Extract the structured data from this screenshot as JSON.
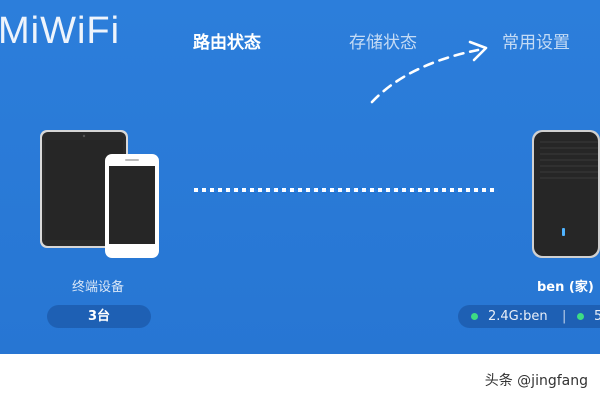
{
  "brand": {
    "name": "MiWiFi"
  },
  "nav": {
    "tabs": [
      {
        "label": "路由状态",
        "active": true
      },
      {
        "label": "存储状态",
        "active": false
      },
      {
        "label": "常用设置",
        "active": false
      }
    ]
  },
  "devices": {
    "label": "终端设备",
    "count": "3台"
  },
  "router": {
    "name": "ben (家)",
    "band_a": "2.4G:ben",
    "separator": "|",
    "band_b": "5"
  },
  "watermark": {
    "text": "头条 @jingfang"
  },
  "colors": {
    "background": "#2a7ad7",
    "status_dot": "#3ddc84",
    "router_led": "#4fb3ff"
  }
}
